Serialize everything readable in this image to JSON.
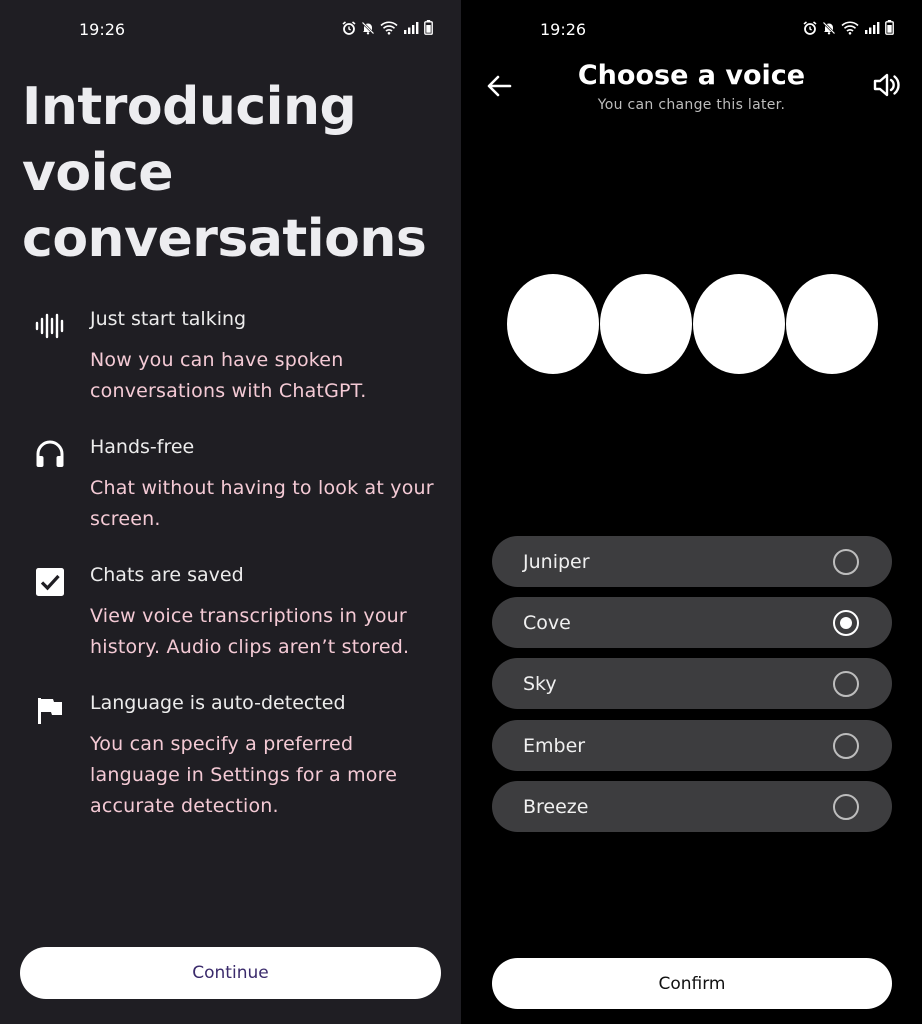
{
  "left": {
    "status": {
      "time": "19:26"
    },
    "title": "Introducing voice conversations",
    "features": [
      {
        "icon": "waveform-icon",
        "heading": "Just start talking",
        "text": "Now you can have spoken conversations with ChatGPT."
      },
      {
        "icon": "headphones-icon",
        "heading": "Hands-free",
        "text": "Chat without having to look at your screen."
      },
      {
        "icon": "checkbox-icon",
        "heading": "Chats are saved",
        "text": "View voice transcriptions in your history. Audio clips aren’t stored."
      },
      {
        "icon": "flag-icon",
        "heading": "Language is auto-detected",
        "text": "You can specify a preferred language in Settings for a more accurate detection."
      }
    ],
    "continue_label": "Continue"
  },
  "right": {
    "status": {
      "time": "19:26"
    },
    "title": "Choose a voice",
    "subtitle": "You can change this later.",
    "voices": [
      {
        "label": "Juniper",
        "selected": false
      },
      {
        "label": "Cove",
        "selected": true
      },
      {
        "label": "Sky",
        "selected": false
      },
      {
        "label": "Ember",
        "selected": false
      },
      {
        "label": "Breeze",
        "selected": false
      }
    ],
    "confirm_label": "Confirm"
  },
  "colors": {
    "left_background": "#1f1e23",
    "right_background": "#000000",
    "feature_text": "#f4cad5",
    "option_background": "#3d3d3f",
    "continue_text": "#3a2a6b"
  }
}
